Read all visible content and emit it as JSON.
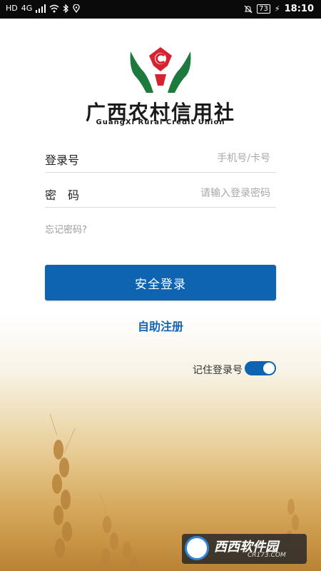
{
  "status_bar": {
    "left_icons": [
      "HD",
      "4G",
      "signal-icon",
      "wifi-icon",
      "bluetooth-icon",
      "location-icon"
    ],
    "hd_text": "HD",
    "network_text": "4G",
    "battery": "73",
    "time": "18:10"
  },
  "brand": {
    "name_cn": "广西农村信用社",
    "name_en": "GuangXi Rural Credit Union",
    "logo_colors": {
      "green": "#1b7a3c",
      "red": "#d5232f"
    }
  },
  "form": {
    "account_label": "登录号",
    "account_placeholder": "手机号/卡号",
    "password_label": "密　码",
    "password_placeholder": "请输入登录密码",
    "forgot_password": "忘记密码?",
    "login_button": "安全登录",
    "register_link": "自助注册",
    "remember_label": "记住登录号",
    "remember_enabled": true
  },
  "watermark": {
    "name_cn": "西西软件园",
    "name_en": "CR173.COM"
  },
  "colors": {
    "primary": "#0f64b2",
    "link": "#1565b5",
    "status_bar": "#0a0a0a"
  }
}
